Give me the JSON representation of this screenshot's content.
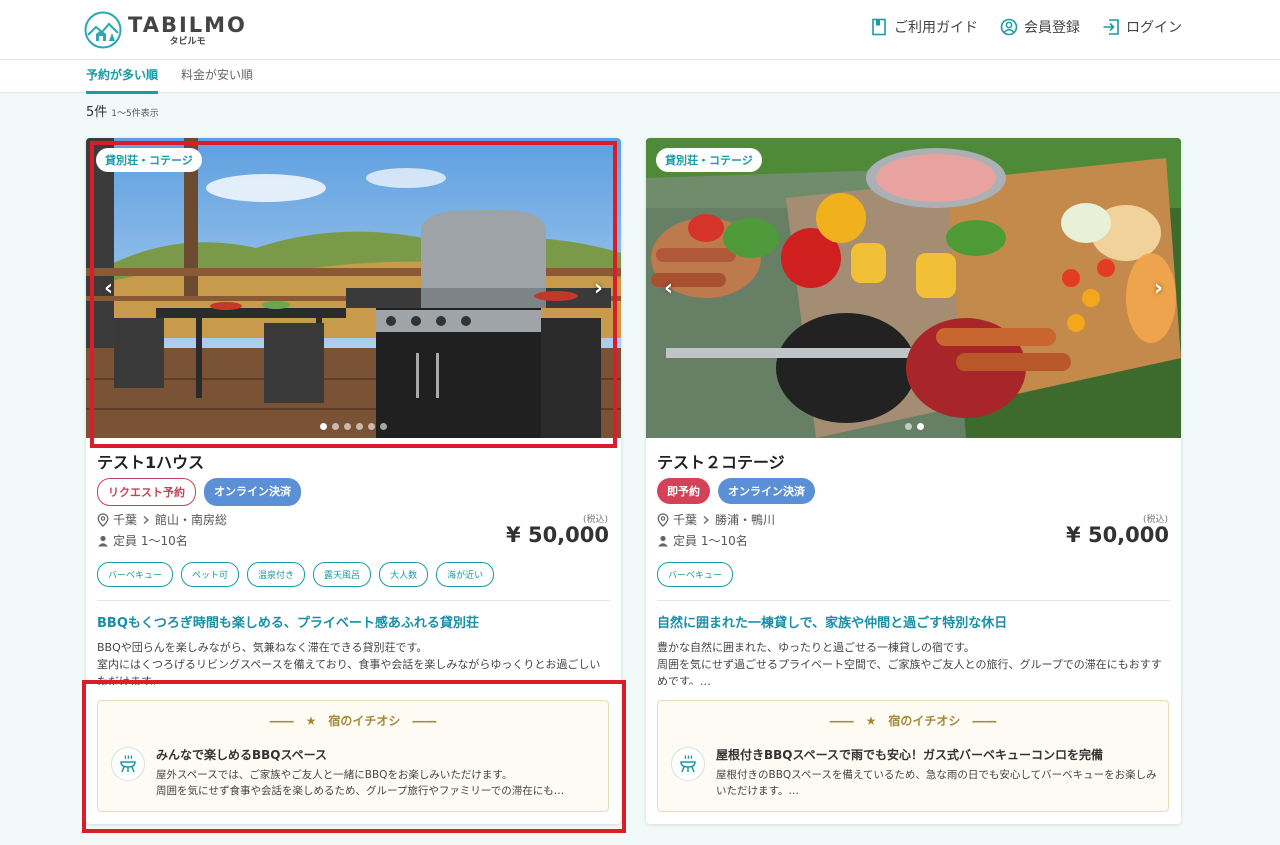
{
  "logo": {
    "main": "TABILMO",
    "sub": "タビルモ"
  },
  "nav": {
    "guide": "ご利用ガイド",
    "register": "会員登録",
    "login": "ログイン"
  },
  "sort": {
    "popular": "予約が多い順",
    "cheap": "料金が安い順"
  },
  "results": {
    "count": "5件",
    "range": "1〜5件表示"
  },
  "common": {
    "tax": "(税込)",
    "online": "オンライン決済",
    "recommend_title": "――　★　宿のイチオシ　――",
    "prev": "‹",
    "next": "›"
  },
  "cards": [
    {
      "category": "貸別荘・コテージ",
      "title": "テスト1ハウス",
      "booking_tag": "リクエスト予約",
      "pref": "千葉",
      "area": "館山・南房総",
      "capacity": "定員 1〜10名",
      "price": "¥ 50,000",
      "amenities": [
        "バーベキュー",
        "ペット可",
        "温泉付き",
        "露天風呂",
        "大人数",
        "海が近い"
      ],
      "headline": "BBQもくつろぎ時間も楽しめる、プライベート感あふれる貸別荘",
      "desc": "BBQや団らんを楽しみながら、気兼ねなく滞在できる貸別荘です。\n室内にはくつろげるリビングスペースを備えており、食事や会話を楽しみながらゆっくりとお過ごしいただけます。",
      "rec_head": "みんなで楽しめるBBQスペース",
      "rec_text": "屋外スペースでは、ご家族やご友人と一緒にBBQをお楽しみいただけます。\n周囲を気にせず食事や会話を楽しめるため、グループ旅行やファミリーでの滞在にも…"
    },
    {
      "category": "貸別荘・コテージ",
      "title": "テスト２コテージ",
      "booking_tag": "即予約",
      "pref": "千葉",
      "area": "勝浦・鴨川",
      "capacity": "定員 1〜10名",
      "price": "¥ 50,000",
      "amenities": [
        "バーベキュー"
      ],
      "headline": "自然に囲まれた一棟貸しで、家族や仲間と過ごす特別な休日",
      "desc": "豊かな自然に囲まれた、ゆったりと過ごせる一棟貸しの宿です。\n周囲を気にせず過ごせるプライベート空間で、ご家族やご友人との旅行、グループでの滞在にもおすすめです。…",
      "rec_head": "屋根付きBBQスペースで雨でも安心！ガス式バーベキューコンロを完備",
      "rec_text": "屋根付きのBBQスペースを備えているため、急な雨の日でも安心してバーベキューをお楽しみいただけます。…"
    }
  ],
  "colors": {
    "accent": "#1a9ba6",
    "request": "#c1435a",
    "instant": "#d44258",
    "online": "#5b8fd6",
    "highlight": "#d91e2b"
  }
}
